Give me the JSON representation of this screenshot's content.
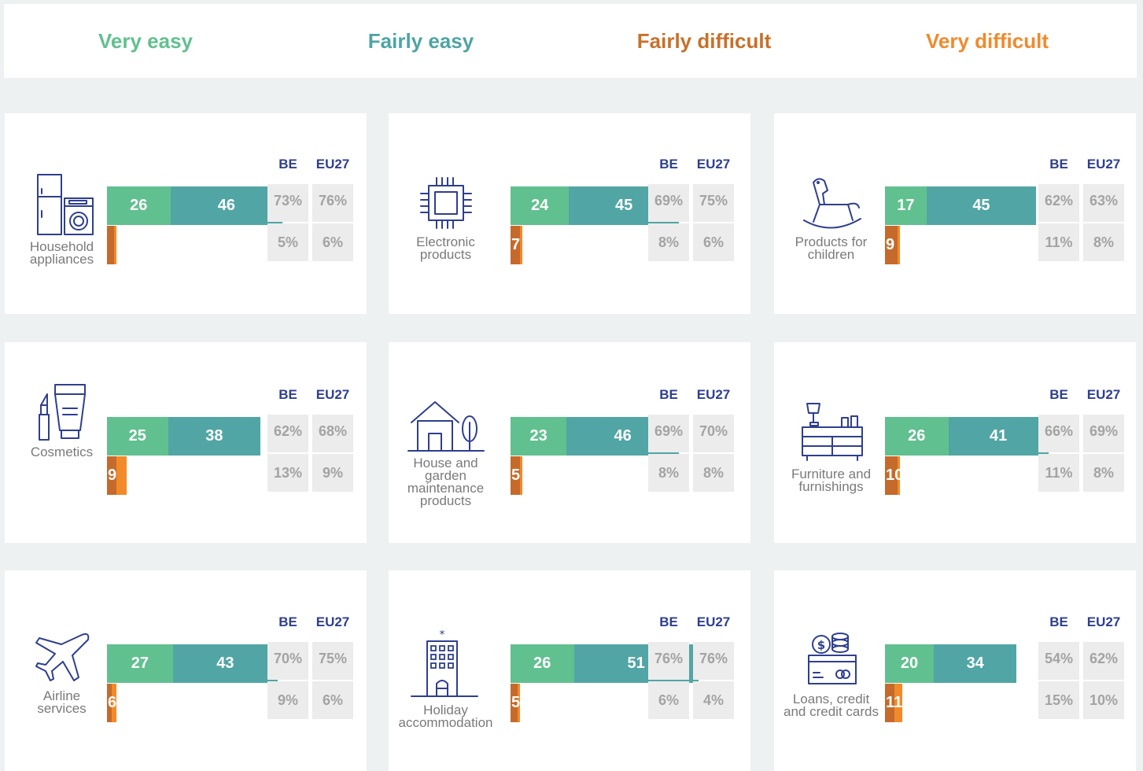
{
  "legend": [
    {
      "label": "Very easy",
      "color": "#61c08f"
    },
    {
      "label": "Fairly easy",
      "color": "#4fa4a4"
    },
    {
      "label": "Fairly difficult",
      "color": "#c8702a"
    },
    {
      "label": "Very difficult",
      "color": "#f08a2c"
    }
  ],
  "colors": {
    "very_easy": "#61c08f",
    "fairly_easy": "#52a5a5",
    "fairly_difficult": "#c56a2a",
    "very_difficult": "#f28a2a",
    "header": "#2e3f8f",
    "icon": "#2e3f8f"
  },
  "chart_data": {
    "type": "bar",
    "columns": [
      "BE",
      "EU27"
    ],
    "series": [
      {
        "name": "Very easy"
      },
      {
        "name": "Fairly easy"
      },
      {
        "name": "Fairly difficult"
      },
      {
        "name": "Very difficult"
      }
    ],
    "panels": [
      {
        "category": "Household appliances",
        "icon": "household-appliances-icon",
        "very_easy": 26,
        "fairly_easy": 46,
        "fairly_difficult": 3,
        "very_difficult": 1,
        "difficult_label": "",
        "easy_be": "73%",
        "easy_eu": "76%",
        "difficult_be": "5%",
        "difficult_eu": "6%"
      },
      {
        "category": "Electronic products",
        "icon": "microchip-icon",
        "very_easy": 24,
        "fairly_easy": 45,
        "fairly_difficult": 4,
        "very_difficult": 1,
        "difficult_label": "7",
        "easy_be": "69%",
        "easy_eu": "75%",
        "difficult_be": "8%",
        "difficult_eu": "6%"
      },
      {
        "category": "Products for children",
        "icon": "rocking-horse-icon",
        "very_easy": 17,
        "fairly_easy": 45,
        "fairly_difficult": 5,
        "very_difficult": 1,
        "difficult_label": "9",
        "easy_be": "62%",
        "easy_eu": "63%",
        "difficult_be": "11%",
        "difficult_eu": "8%"
      },
      {
        "category": "Cosmetics",
        "icon": "cosmetics-icon",
        "very_easy": 25,
        "fairly_easy": 38,
        "fairly_difficult": 4,
        "very_difficult": 4,
        "difficult_label": "9",
        "easy_be": "62%",
        "easy_eu": "68%",
        "difficult_be": "13%",
        "difficult_eu": "9%"
      },
      {
        "category": "House and garden maintenance products",
        "icon": "house-garden-icon",
        "very_easy": 23,
        "fairly_easy": 46,
        "fairly_difficult": 4,
        "very_difficult": 1,
        "difficult_label": "5",
        "easy_be": "69%",
        "easy_eu": "70%",
        "difficult_be": "8%",
        "difficult_eu": "8%"
      },
      {
        "category": "Furniture and furnishings",
        "icon": "furniture-icon",
        "very_easy": 26,
        "fairly_easy": 41,
        "fairly_difficult": 5,
        "very_difficult": 1,
        "difficult_label": "10",
        "easy_be": "66%",
        "easy_eu": "69%",
        "difficult_be": "11%",
        "difficult_eu": "8%"
      },
      {
        "category": "Airline services",
        "icon": "airplane-icon",
        "very_easy": 27,
        "fairly_easy": 43,
        "fairly_difficult": 2,
        "very_difficult": 2,
        "difficult_label": "6",
        "easy_be": "70%",
        "easy_eu": "75%",
        "difficult_be": "9%",
        "difficult_eu": "6%"
      },
      {
        "category": "Holiday accommodation",
        "icon": "hotel-icon",
        "very_easy": 26,
        "fairly_easy": 51,
        "fairly_difficult": 3,
        "very_difficult": 1,
        "difficult_label": "5",
        "easy_be": "76%",
        "easy_eu": "76%",
        "difficult_be": "6%",
        "difficult_eu": "4%"
      },
      {
        "category": "Loans, credit and credit cards",
        "icon": "credit-card-icon",
        "very_easy": 20,
        "fairly_easy": 34,
        "fairly_difficult": 4,
        "very_difficult": 3,
        "difficult_label": "11",
        "easy_be": "54%",
        "easy_eu": "62%",
        "difficult_be": "15%",
        "difficult_eu": "10%"
      }
    ]
  },
  "labels": [
    [
      "Household",
      "appliances"
    ],
    [
      "Electronic",
      "products"
    ],
    [
      "Products for",
      "children"
    ],
    [
      "Cosmetics"
    ],
    [
      "House and",
      "garden",
      "maintenance",
      "products"
    ],
    [
      "Furniture and",
      "furnishings"
    ],
    [
      "Airline",
      "services"
    ],
    [
      "Holiday",
      "accommodation"
    ],
    [
      "Loans, credit",
      "and credit cards"
    ]
  ]
}
